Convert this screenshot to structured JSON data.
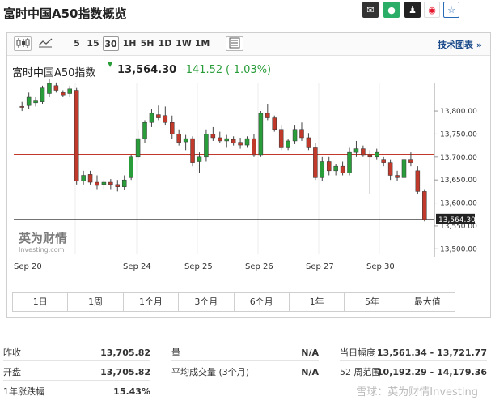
{
  "title": "富时中国A50指数概览",
  "share_icons": [
    {
      "name": "mail-icon",
      "glyph": "✉"
    },
    {
      "name": "wechat-icon",
      "glyph": "●"
    },
    {
      "name": "qq-icon",
      "glyph": "♟"
    },
    {
      "name": "weibo-icon",
      "glyph": "◉"
    },
    {
      "name": "star-icon",
      "glyph": "☆"
    }
  ],
  "toolbar": {
    "intervals": [
      "5",
      "15",
      "30",
      "1H",
      "5H",
      "1D",
      "1W",
      "1M"
    ],
    "active_interval": "30",
    "tech_chart_label": "技术图表 »"
  },
  "quote": {
    "name": "富时中国A50指数",
    "arrow": "▼",
    "price": "13,564.30",
    "change": "-141.52",
    "change_pct": "(-1.03%)",
    "down_color": "#2a9d3b"
  },
  "chart_data": {
    "type": "candlestick",
    "title": "",
    "xlabel": "",
    "ylabel": "",
    "ylim": [
      13490,
      13860
    ],
    "y_ticks": [
      "13,800.00",
      "13,750.00",
      "13,700.00",
      "13,650.00",
      "13,600.00",
      "13,550.00",
      "13,500.00"
    ],
    "y_tick_values": [
      13800,
      13750,
      13700,
      13650,
      13600,
      13550,
      13500
    ],
    "x_ticks": [
      "Sep 20",
      "Sep 24",
      "Sep 25",
      "Sep 26",
      "Sep 27",
      "Sep 30"
    ],
    "reference_line": {
      "value": 13705.82
    },
    "last_price": {
      "value": 13564.3,
      "label": "13,564.30"
    },
    "up_color": "#2a9d3b",
    "down_color": "#c0392b",
    "candles": [
      {
        "o": 13810,
        "h": 13820,
        "l": 13800,
        "c": 13808
      },
      {
        "o": 13812,
        "h": 13840,
        "l": 13805,
        "c": 13830
      },
      {
        "o": 13818,
        "h": 13830,
        "l": 13810,
        "c": 13822
      },
      {
        "o": 13820,
        "h": 13855,
        "l": 13815,
        "c": 13850
      },
      {
        "o": 13838,
        "h": 13870,
        "l": 13830,
        "c": 13860
      },
      {
        "o": 13855,
        "h": 13862,
        "l": 13840,
        "c": 13845
      },
      {
        "o": 13840,
        "h": 13845,
        "l": 13830,
        "c": 13835
      },
      {
        "o": 13838,
        "h": 13855,
        "l": 13830,
        "c": 13848
      },
      {
        "o": 13845,
        "h": 13850,
        "l": 13640,
        "c": 13648
      },
      {
        "o": 13648,
        "h": 13670,
        "l": 13640,
        "c": 13660
      },
      {
        "o": 13662,
        "h": 13670,
        "l": 13640,
        "c": 13645
      },
      {
        "o": 13645,
        "h": 13660,
        "l": 13630,
        "c": 13638
      },
      {
        "o": 13640,
        "h": 13650,
        "l": 13630,
        "c": 13645
      },
      {
        "o": 13645,
        "h": 13652,
        "l": 13630,
        "c": 13640
      },
      {
        "o": 13640,
        "h": 13650,
        "l": 13625,
        "c": 13635
      },
      {
        "o": 13635,
        "h": 13660,
        "l": 13628,
        "c": 13650
      },
      {
        "o": 13655,
        "h": 13705,
        "l": 13650,
        "c": 13700
      },
      {
        "o": 13700,
        "h": 13760,
        "l": 13695,
        "c": 13740
      },
      {
        "o": 13740,
        "h": 13780,
        "l": 13730,
        "c": 13775
      },
      {
        "o": 13775,
        "h": 13805,
        "l": 13765,
        "c": 13795
      },
      {
        "o": 13792,
        "h": 13812,
        "l": 13780,
        "c": 13785
      },
      {
        "o": 13790,
        "h": 13810,
        "l": 13770,
        "c": 13775
      },
      {
        "o": 13775,
        "h": 13790,
        "l": 13740,
        "c": 13750
      },
      {
        "o": 13750,
        "h": 13760,
        "l": 13725,
        "c": 13732
      },
      {
        "o": 13733,
        "h": 13748,
        "l": 13715,
        "c": 13740
      },
      {
        "o": 13740,
        "h": 13745,
        "l": 13680,
        "c": 13688
      },
      {
        "o": 13690,
        "h": 13710,
        "l": 13665,
        "c": 13700
      },
      {
        "o": 13700,
        "h": 13760,
        "l": 13690,
        "c": 13750
      },
      {
        "o": 13750,
        "h": 13765,
        "l": 13735,
        "c": 13742
      },
      {
        "o": 13742,
        "h": 13755,
        "l": 13730,
        "c": 13735
      },
      {
        "o": 13735,
        "h": 13748,
        "l": 13720,
        "c": 13740
      },
      {
        "o": 13738,
        "h": 13745,
        "l": 13725,
        "c": 13730
      },
      {
        "o": 13732,
        "h": 13742,
        "l": 13718,
        "c": 13726
      },
      {
        "o": 13726,
        "h": 13745,
        "l": 13720,
        "c": 13740
      },
      {
        "o": 13740,
        "h": 13750,
        "l": 13700,
        "c": 13705
      },
      {
        "o": 13705,
        "h": 13800,
        "l": 13700,
        "c": 13795
      },
      {
        "o": 13795,
        "h": 13815,
        "l": 13780,
        "c": 13785
      },
      {
        "o": 13785,
        "h": 13790,
        "l": 13755,
        "c": 13760
      },
      {
        "o": 13760,
        "h": 13770,
        "l": 13715,
        "c": 13720
      },
      {
        "o": 13720,
        "h": 13740,
        "l": 13715,
        "c": 13735
      },
      {
        "o": 13735,
        "h": 13770,
        "l": 13728,
        "c": 13760
      },
      {
        "o": 13760,
        "h": 13775,
        "l": 13735,
        "c": 13742
      },
      {
        "o": 13742,
        "h": 13752,
        "l": 13715,
        "c": 13720
      },
      {
        "o": 13720,
        "h": 13730,
        "l": 13650,
        "c": 13655
      },
      {
        "o": 13655,
        "h": 13700,
        "l": 13648,
        "c": 13690
      },
      {
        "o": 13690,
        "h": 13700,
        "l": 13660,
        "c": 13670
      },
      {
        "o": 13670,
        "h": 13685,
        "l": 13660,
        "c": 13680
      },
      {
        "o": 13680,
        "h": 13690,
        "l": 13660,
        "c": 13665
      },
      {
        "o": 13665,
        "h": 13720,
        "l": 13660,
        "c": 13710
      },
      {
        "o": 13710,
        "h": 13735,
        "l": 13700,
        "c": 13718
      },
      {
        "o": 13718,
        "h": 13725,
        "l": 13700,
        "c": 13705
      },
      {
        "o": 13705,
        "h": 13715,
        "l": 13620,
        "c": 13700
      },
      {
        "o": 13700,
        "h": 13718,
        "l": 13695,
        "c": 13710
      },
      {
        "o": 13695,
        "h": 13700,
        "l": 13680,
        "c": 13688
      },
      {
        "o": 13688,
        "h": 13695,
        "l": 13650,
        "c": 13660
      },
      {
        "o": 13660,
        "h": 13670,
        "l": 13648,
        "c": 13655
      },
      {
        "o": 13655,
        "h": 13700,
        "l": 13650,
        "c": 13695
      },
      {
        "o": 13695,
        "h": 13710,
        "l": 13680,
        "c": 13688
      },
      {
        "o": 13670,
        "h": 13680,
        "l": 13620,
        "c": 13625
      },
      {
        "o": 13625,
        "h": 13630,
        "l": 13560,
        "c": 13564
      }
    ]
  },
  "logo": {
    "line1": "英为财情",
    "line2": "Investing.com"
  },
  "ranges": [
    "1日",
    "1周",
    "1个月",
    "3个月",
    "6个月",
    "1年",
    "5年",
    "最大值"
  ],
  "stats": {
    "left": [
      {
        "label": "昨收",
        "value": "13,705.82"
      },
      {
        "label": "开盘",
        "value": "13,705.82"
      },
      {
        "label": "1年涨跌幅",
        "value": "15.43%"
      }
    ],
    "middle": [
      {
        "label": "量",
        "value": "N/A"
      },
      {
        "label": "平均成交量 (3个月)",
        "value": "N/A"
      }
    ],
    "right": [
      {
        "label": "当日幅度",
        "value": "13,561.34 - 13,721.77"
      },
      {
        "label": "52 周范围",
        "value": "10,192.29 - 14,179.36"
      }
    ]
  },
  "watermark": "雪球：英为财情Investing"
}
